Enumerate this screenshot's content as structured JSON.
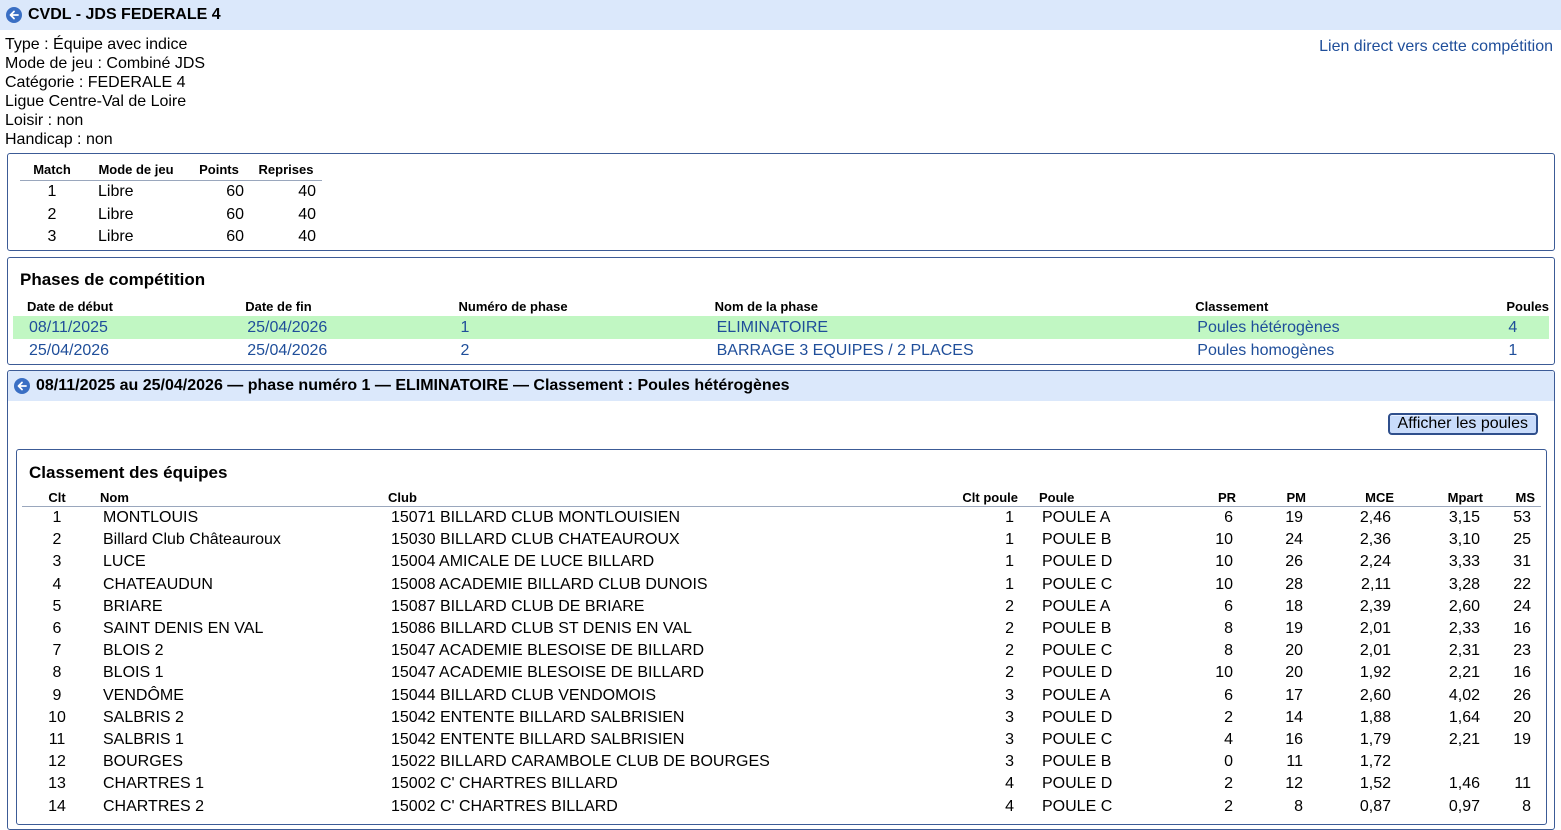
{
  "header": {
    "title": "CVDL - JDS FEDERALE 4"
  },
  "info": {
    "lines": [
      "Type : Équipe avec indice",
      "Mode de jeu : Combiné JDS",
      "Catégorie : FEDERALE 4",
      "Ligue Centre-Val de Loire",
      "Loisir : non",
      "Handicap : non"
    ],
    "direct_link": "Lien direct vers cette compétition"
  },
  "matches": {
    "headers": [
      "Match",
      "Mode de jeu",
      "Points",
      "Reprises"
    ],
    "rows": [
      [
        "1",
        "Libre",
        "60",
        "40"
      ],
      [
        "2",
        "Libre",
        "60",
        "40"
      ],
      [
        "3",
        "Libre",
        "60",
        "40"
      ]
    ]
  },
  "phases": {
    "title": "Phases de compétition",
    "headers": [
      "Date de début",
      "Date de fin",
      "Numéro de phase",
      "Nom de la phase",
      "Classement",
      "Poules"
    ],
    "rows": [
      [
        "08/11/2025",
        "25/04/2026",
        "1",
        "ELIMINATOIRE",
        "Poules hétérogènes",
        "4"
      ],
      [
        "25/04/2026",
        "25/04/2026",
        "2",
        "BARRAGE 3 EQUIPES / 2 PLACES",
        "Poules homogènes",
        "1"
      ]
    ],
    "highlight_color": "#c1f7c3"
  },
  "phase_detail": {
    "title": "08/11/2025 au 25/04/2026 — phase numéro 1 — ELIMINATOIRE — Classement : Poules hétérogènes",
    "show_pools_button": "Afficher les poules"
  },
  "ranking": {
    "title": "Classement des équipes",
    "headers": [
      "Clt",
      "Nom",
      "Club",
      "Clt poule",
      "Poule",
      "PR",
      "PM",
      "MCE",
      "Mpart",
      "MS"
    ],
    "rows": [
      [
        "1",
        "MONTLOUIS",
        "15071 BILLARD CLUB MONTLOUISIEN",
        "1",
        "POULE A",
        "6",
        "19",
        "2,46",
        "3,15",
        "53"
      ],
      [
        "2",
        "Billard Club Châteauroux",
        "15030 BILLARD CLUB CHATEAUROUX",
        "1",
        "POULE B",
        "10",
        "24",
        "2,36",
        "3,10",
        "25"
      ],
      [
        "3",
        "LUCE",
        "15004 AMICALE DE LUCE BILLARD",
        "1",
        "POULE D",
        "10",
        "26",
        "2,24",
        "3,33",
        "31"
      ],
      [
        "4",
        "CHATEAUDUN",
        "15008 ACADEMIE BILLARD CLUB DUNOIS",
        "1",
        "POULE C",
        "10",
        "28",
        "2,11",
        "3,28",
        "22"
      ],
      [
        "5",
        "BRIARE",
        "15087 BILLARD CLUB DE BRIARE",
        "2",
        "POULE A",
        "6",
        "18",
        "2,39",
        "2,60",
        "24"
      ],
      [
        "6",
        "SAINT DENIS EN VAL",
        "15086 BILLARD CLUB ST DENIS EN VAL",
        "2",
        "POULE B",
        "8",
        "19",
        "2,01",
        "2,33",
        "16"
      ],
      [
        "7",
        "BLOIS 2",
        "15047 ACADEMIE BLESOISE DE BILLARD",
        "2",
        "POULE C",
        "8",
        "20",
        "2,01",
        "2,31",
        "23"
      ],
      [
        "8",
        "BLOIS 1",
        "15047 ACADEMIE BLESOISE DE BILLARD",
        "2",
        "POULE D",
        "10",
        "20",
        "1,92",
        "2,21",
        "16"
      ],
      [
        "9",
        "VENDÔME",
        "15044 BILLARD CLUB VENDOMOIS",
        "3",
        "POULE A",
        "6",
        "17",
        "2,60",
        "4,02",
        "26"
      ],
      [
        "10",
        "SALBRIS 2",
        "15042 ENTENTE BILLARD SALBRISIEN",
        "3",
        "POULE D",
        "2",
        "14",
        "1,88",
        "1,64",
        "20"
      ],
      [
        "11",
        "SALBRIS 1",
        "15042 ENTENTE BILLARD SALBRISIEN",
        "3",
        "POULE C",
        "4",
        "16",
        "1,79",
        "2,21",
        "19"
      ],
      [
        "12",
        "BOURGES",
        "15022 BILLARD CARAMBOLE CLUB DE BOURGES",
        "3",
        "POULE B",
        "0",
        "11",
        "1,72",
        "",
        ""
      ],
      [
        "13",
        "CHARTRES 1",
        "15002 C' CHARTRES BILLARD",
        "4",
        "POULE D",
        "2",
        "12",
        "1,52",
        "1,46",
        "11"
      ],
      [
        "14",
        "CHARTRES 2",
        "15002 C' CHARTRES BILLARD",
        "4",
        "POULE C",
        "2",
        "8",
        "0,87",
        "0,97",
        "8"
      ]
    ]
  }
}
